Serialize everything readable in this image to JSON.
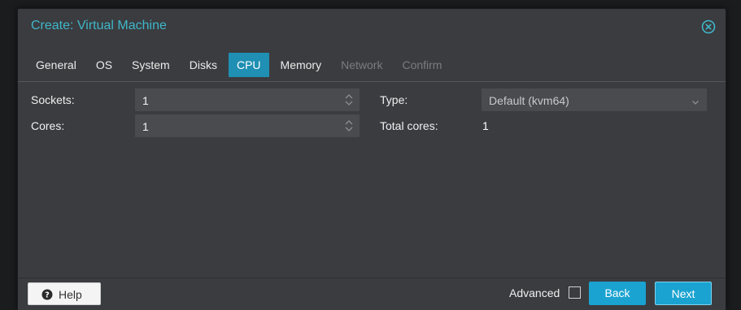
{
  "dialog": {
    "title": "Create: Virtual Machine"
  },
  "tabs": [
    {
      "label": "General",
      "state": "normal"
    },
    {
      "label": "OS",
      "state": "normal"
    },
    {
      "label": "System",
      "state": "normal"
    },
    {
      "label": "Disks",
      "state": "normal"
    },
    {
      "label": "CPU",
      "state": "active"
    },
    {
      "label": "Memory",
      "state": "normal"
    },
    {
      "label": "Network",
      "state": "disabled"
    },
    {
      "label": "Confirm",
      "state": "disabled"
    }
  ],
  "form": {
    "sockets": {
      "label": "Sockets:",
      "value": "1"
    },
    "cores": {
      "label": "Cores:",
      "value": "1"
    },
    "type": {
      "label": "Type:",
      "value": "Default (kvm64)"
    },
    "total_cores": {
      "label": "Total cores:",
      "value": "1"
    }
  },
  "footer": {
    "help_label": "Help",
    "advanced_label": "Advanced",
    "advanced_checked": false,
    "back_label": "Back",
    "next_label": "Next"
  },
  "colors": {
    "accent": "#3fb7c9",
    "active_tab": "#1f8fb3",
    "button_blue": "#1aa3d1"
  },
  "icons": {
    "close": "circle-x-icon",
    "help": "question-circle-icon",
    "spinner": "up-down-chevron-icon",
    "dropdown": "chevron-down-icon"
  }
}
